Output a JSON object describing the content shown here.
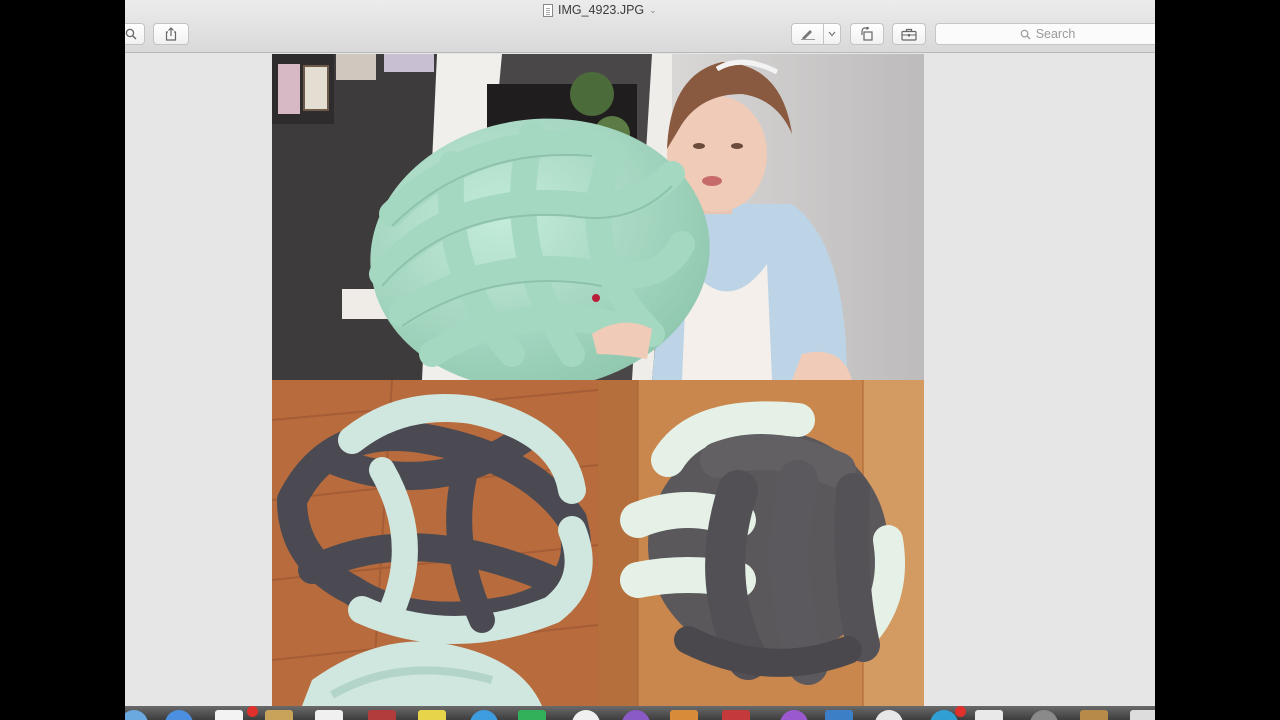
{
  "window": {
    "title": "IMG_4923.JPG",
    "title_chevron": "⌄"
  },
  "toolbar": {
    "zoom_icon": "magnifier-icon",
    "share_icon": "share-icon",
    "markup_icon": "pen-icon",
    "markup_menu_icon": "chevron-down-icon",
    "rotate_icon": "rotate-icon",
    "toolbox_icon": "toolbox-icon",
    "search_placeholder": "Search"
  },
  "image": {
    "description_panels": [
      "mint-knot-pillow-with-woman",
      "grey-mint-celtic-knot-pillow",
      "grey-mint-ball-knot-pillow"
    ],
    "colors": {
      "mint": "#a9dcc5",
      "grey": "#4b4a52",
      "wood": "#b66a3e",
      "wall": "#4a4748"
    }
  },
  "dock": {
    "badge_count": "5",
    "app_icons": [
      "safari-icon",
      "mail-icon",
      "calendar-icon",
      "notes-icon",
      "photos-icon",
      "messages-icon",
      "facetime-icon",
      "itunes-icon",
      "finder-icon",
      "preview-icon",
      "keynote-icon",
      "pages-icon",
      "app-store-icon",
      "system-preferences-icon",
      "trash-icon"
    ]
  }
}
